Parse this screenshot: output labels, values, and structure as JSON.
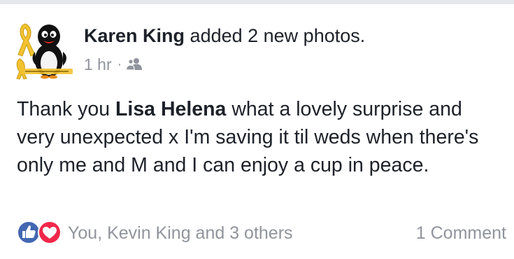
{
  "post": {
    "author": "Karen King",
    "action": "added 2 new photos.",
    "time": "1 hr",
    "separator": "·",
    "privacy_icon": "friends-icon",
    "text_before": "Thank you ",
    "tagged_name": "Lisa Helena",
    "text_after": " what a lovely surprise and very unexpected x I'm saving it til weds when there's only me and M and I can enjoy a cup in peace."
  },
  "footer": {
    "reaction_icons": [
      "like-icon",
      "love-icon"
    ],
    "reactions_text": "You, Kevin King and 3 others",
    "comments_text": "1 Comment"
  },
  "colors": {
    "text": "#1d2129",
    "meta": "#90949c",
    "like_blue": "#4267b2",
    "love_red": "#f0284a",
    "ribbon_gold": "#f2c230"
  }
}
